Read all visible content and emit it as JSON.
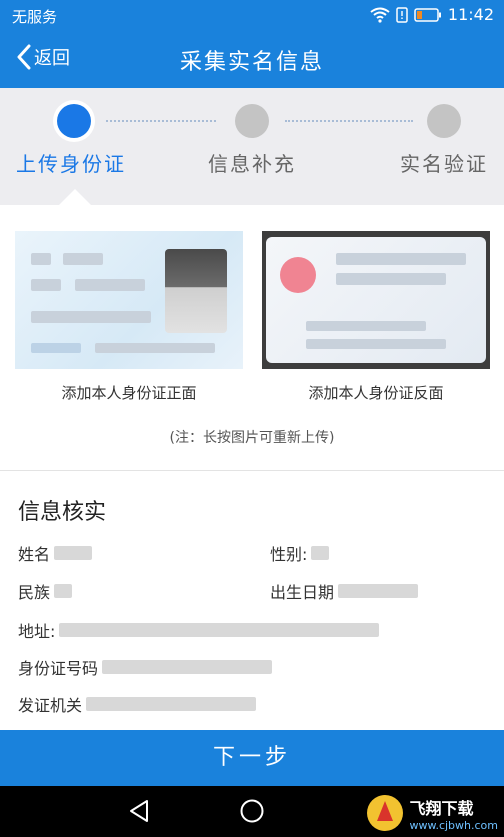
{
  "status_bar": {
    "carrier": "无服务",
    "time": "11:42"
  },
  "header": {
    "back_label": "返回",
    "title": "采集实名信息"
  },
  "steps": [
    {
      "label": "上传身份证",
      "state": "active"
    },
    {
      "label": "信息补充",
      "state": "pending"
    },
    {
      "label": "实名验证",
      "state": "pending"
    }
  ],
  "upload": {
    "front_label": "添加本人身份证正面",
    "back_label": "添加本人身份证反面",
    "note": "(注：长按图片可重新上传)"
  },
  "verify": {
    "title": "信息核实",
    "fields": {
      "name": "姓名",
      "gender": "性别:",
      "ethnicity": "民族",
      "birth": "出生日期",
      "address": "地址:",
      "id_number": "身份证号码",
      "issuer": "发证机关"
    }
  },
  "next_button": "下一步",
  "watermark": {
    "line1": "飞翔下载",
    "line2": "www.cjbwh.com"
  },
  "colors": {
    "primary": "#1a82dc",
    "step_active": "#1a78e6",
    "step_idle": "#c4c4c4"
  }
}
